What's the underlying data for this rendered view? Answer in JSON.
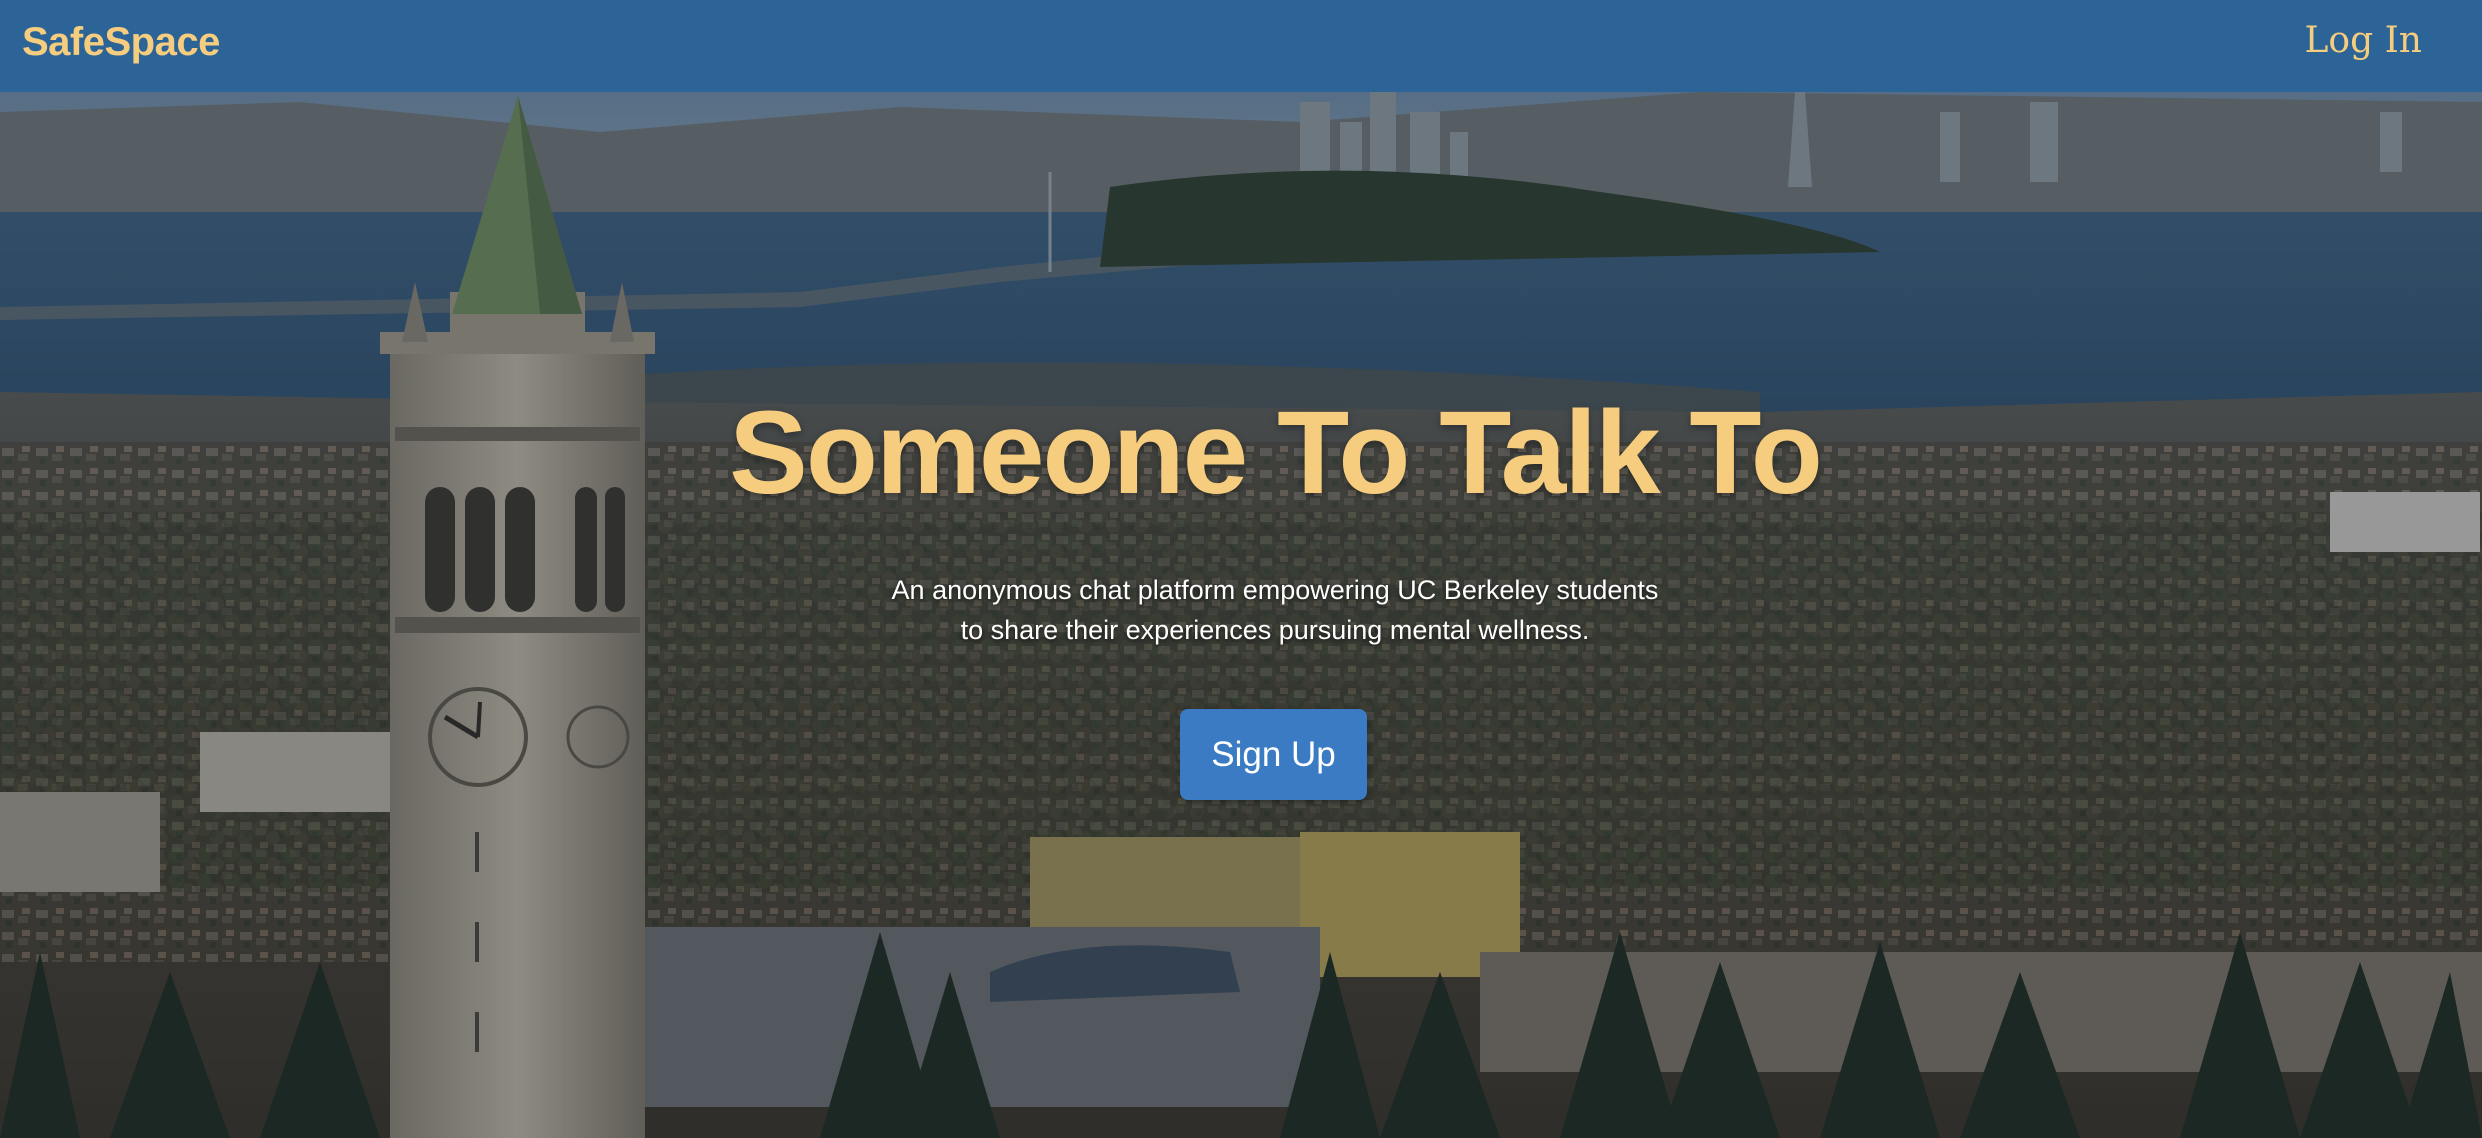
{
  "navbar": {
    "brand": "SafeSpace",
    "login_label": "Log In"
  },
  "hero": {
    "title": "Someone To Talk To",
    "subtitle_lines": [
      "An anonymous chat platform empowering UC Berkeley students",
      "to share their experiences pursuing mental wellness."
    ],
    "signup_label": "Sign Up",
    "background": "photo of UC Berkeley campanile overlooking the bay"
  },
  "colors": {
    "navbar": "#2d6498",
    "accent_gold": "#f6cd7e",
    "button": "#3a7bc4"
  }
}
